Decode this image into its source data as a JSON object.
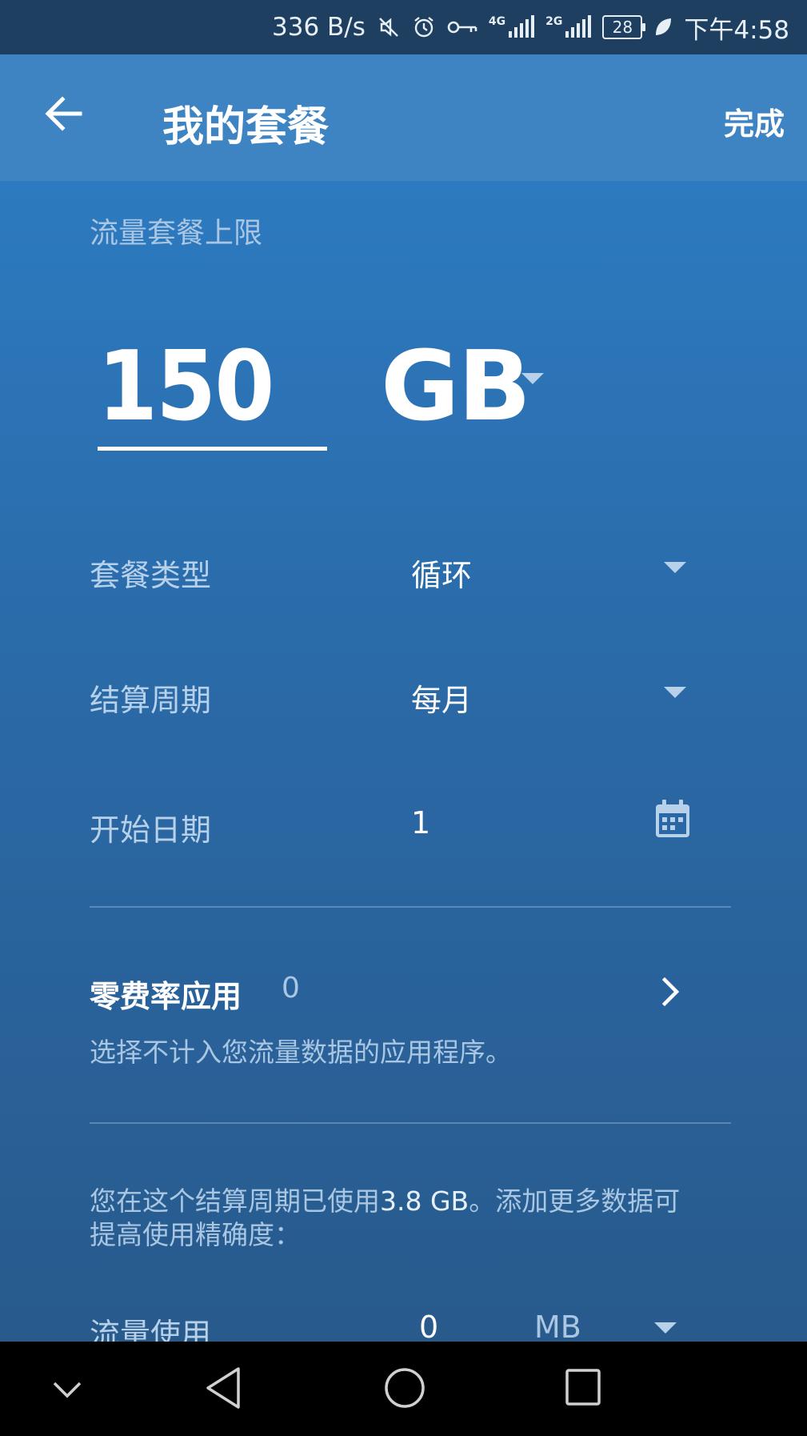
{
  "status_bar": {
    "net_speed": "336 B/s",
    "network_1": "4G",
    "network_2": "2G",
    "battery": "28",
    "time": "下午4:58",
    "icons": [
      "mute-icon",
      "alarm-icon",
      "vpn-key-icon",
      "signal-4g-icon",
      "signal-2g-icon",
      "battery-icon",
      "leaf-icon"
    ]
  },
  "app_bar": {
    "title": "我的套餐",
    "done_label": "完成"
  },
  "plan": {
    "limit_label": "流量套餐上限",
    "limit_value": "150",
    "limit_unit": "GB"
  },
  "rows": {
    "plan_type_label": "套餐类型",
    "plan_type_value": "循环",
    "billing_cycle_label": "结算周期",
    "billing_cycle_value": "每月",
    "start_date_label": "开始日期",
    "start_date_value": "1"
  },
  "zero_rate": {
    "label": "零费率应用",
    "count": "0",
    "description": "选择不计入您流量数据的应用程序。"
  },
  "usage_note": {
    "prefix": "您在这个结算周期已使用",
    "amount": "3.8 GB",
    "suffix": "。添加更多数据可",
    "line2": "提高使用精确度："
  },
  "usage": {
    "label": "流量使用",
    "value": "0",
    "unit": "MB"
  },
  "colors": {
    "app_bar": "#3f84c2",
    "status_bar": "#1f3f60",
    "content_top": "#2d7ac0",
    "content_bottom": "#285a8c",
    "nav_bar": "#000000"
  }
}
